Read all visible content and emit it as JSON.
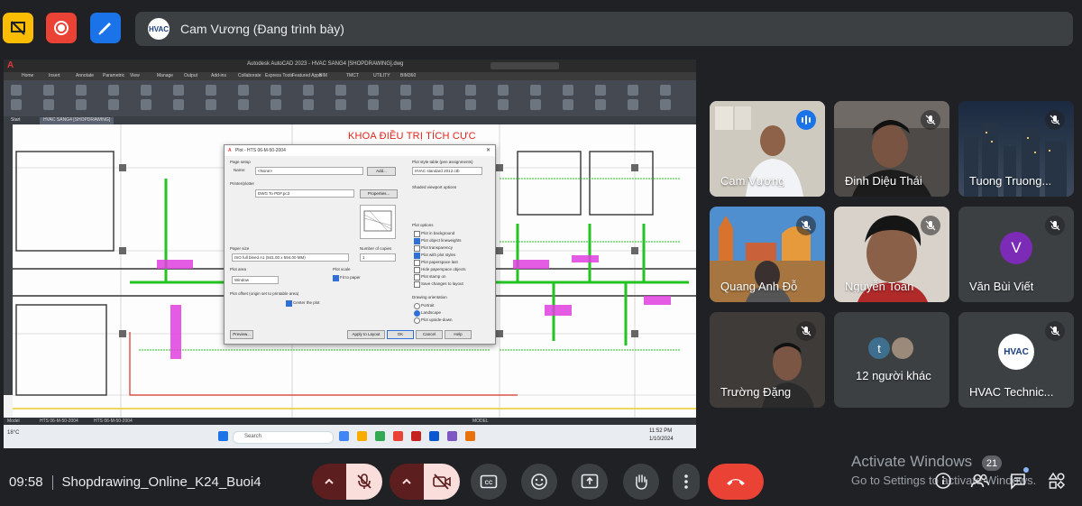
{
  "top_icons": [
    {
      "name": "presentation-off-icon",
      "color": "#fbbc04"
    },
    {
      "name": "record-icon",
      "color": "#ea4335"
    },
    {
      "name": "whiteboard-icon",
      "color": "#1a73e8"
    }
  ],
  "presenter": {
    "avatar_label": "HVAC",
    "text": "Cam Vương (Đang trình bày)"
  },
  "shared_screen": {
    "app_logo": "A",
    "window_title": "Autodesk AutoCAD 2023 - HVAC SANG4 [SHOPDRAWING].dwg",
    "menu": [
      "Home",
      "Insert",
      "Annotate",
      "Parametric",
      "View",
      "Manage",
      "Output",
      "Add-ins",
      "Collaborate",
      "Express Tools",
      "Featured Apps",
      "BIM",
      "TMCT",
      "UTILITY",
      "BIM360"
    ],
    "file_tabs": [
      "Start",
      "HVAC SANG4 [SHOPDRAWING]"
    ],
    "drawing_title": "KHOA ĐIỀU TRỊ TÍCH CỰC",
    "status_tabs": [
      "Model",
      "HTS 06-M-50-2004",
      "HTS 06-M-50-2004"
    ],
    "status_right": "MODEL",
    "taskbar_search": "Search",
    "clock_time": "11:52 PM",
    "clock_date": "1/10/2024",
    "weather": "18°C"
  },
  "plot_dialog": {
    "title": "Plot - HTS 06-M-50-2004",
    "page_setup_label": "Page setup",
    "page_setup_name": "Name:",
    "page_setup_value": "<None>",
    "add_button": "Add...",
    "printer_label": "Printer/plotter",
    "printer_name": "DWG To PDF.pc3",
    "properties_button": "Properties...",
    "paper_size_label": "Paper size",
    "paper_size_value": "ISO full bleed A1 (841.00 x 594.00 MM)",
    "copies_label": "Number of copies",
    "copies_value": "1",
    "plot_area_label": "Plot area",
    "plot_area_value": "Window",
    "plot_scale_label": "Plot scale",
    "fit_to_paper": "Fit to paper",
    "offset_label": "Plot offset (origin set to printable area)",
    "center_plot": "Center the plot",
    "preview_button": "Preview...",
    "apply_button": "Apply to Layout",
    "ok_button": "OK",
    "cancel_button": "Cancel",
    "help_button": "Help",
    "style_table_label": "Plot style table (pen assignments)",
    "style_table_value": "HVAC standard 2012.ctb",
    "viewport_label": "Shaded viewport options",
    "plot_options_label": "Plot options",
    "plot_options": [
      "Plot in background",
      "Plot object lineweights",
      "Plot transparency",
      "Plot with plot styles",
      "Plot paperspace last",
      "Hide paperspace objects",
      "Plot stamp on",
      "Save changes to layout"
    ],
    "orientation_label": "Drawing orientation",
    "orientation_options": [
      "Portrait",
      "Landscape",
      "Plot upside-down"
    ]
  },
  "participants": [
    {
      "name": "Cam Vương",
      "state": "speaking"
    },
    {
      "name": "Đinh Diệu Thái",
      "state": "muted"
    },
    {
      "name": "Tuong Truong...",
      "state": "muted"
    },
    {
      "name": "Quang Anh Đỗ",
      "state": "muted"
    },
    {
      "name": "Nguyễn Toàn",
      "state": "muted"
    },
    {
      "name": "Văn Bùi Viết",
      "state": "muted",
      "avatar_letter": "V",
      "avatar_color": "#7b2bb5"
    },
    {
      "name": "Trường Đặng",
      "state": "muted"
    },
    {
      "name": "12 người khác",
      "state": "others",
      "avatar_letter": "t"
    },
    {
      "name": "HVAC Technic...",
      "state": "muted",
      "avatar_label": "HVAC"
    }
  ],
  "meeting": {
    "time": "09:58",
    "title": "Shopdrawing_Online_K24_Buoi4"
  },
  "controls": {
    "accent_red": "#ea4335",
    "mic_off_color": "#f9dedc",
    "buttons": [
      "mic-options",
      "mic-toggle",
      "camera-options",
      "camera-toggle",
      "captions",
      "reactions",
      "present",
      "raise-hand",
      "more-options",
      "leave-call"
    ]
  },
  "watermark": {
    "line1": "Activate Windows",
    "line2": "Go to Settings to activate Windows."
  },
  "right_tools": {
    "people_badge": "21",
    "items": [
      "info-icon",
      "people-icon",
      "chat-icon",
      "activities-icon"
    ]
  }
}
